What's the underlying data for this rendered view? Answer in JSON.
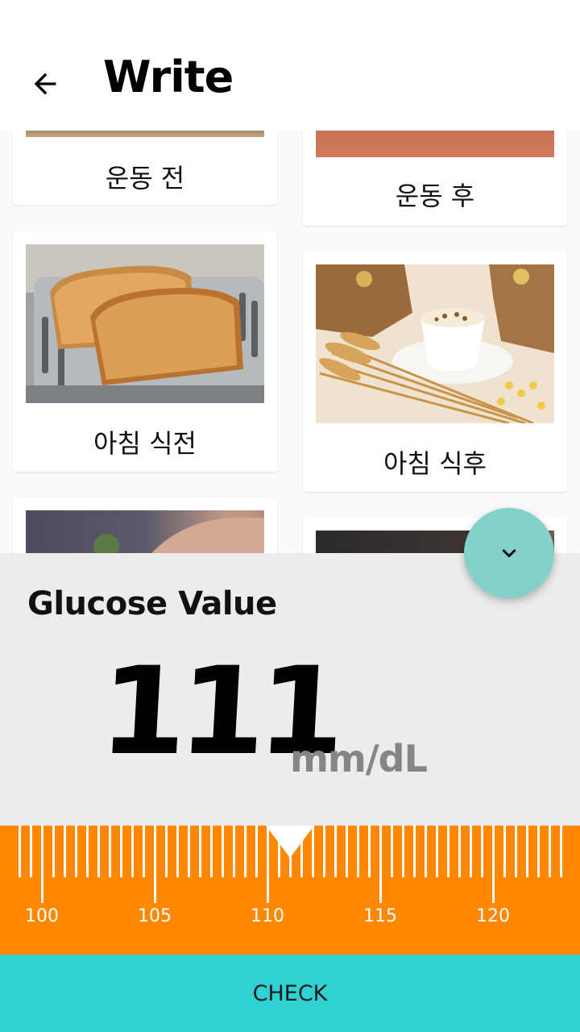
{
  "header": {
    "title": "Write",
    "back_icon": "arrow-back-icon"
  },
  "categories": [
    {
      "label": "운동 전",
      "image": "exercise-before-photo"
    },
    {
      "label": "운동 후",
      "image": "exercise-after-photo"
    },
    {
      "label": "아침 식전",
      "image": "toast-photo"
    },
    {
      "label": "아침 식후",
      "image": "cereal-wheat-photo"
    },
    {
      "label": "",
      "image": "lunch-before-photo"
    },
    {
      "label": "",
      "image": "lunch-after-photo"
    }
  ],
  "glucose": {
    "title": "Glucose Value",
    "value": "111",
    "unit": "mm/dL"
  },
  "fab": {
    "icon": "chevron-down-icon"
  },
  "ruler": {
    "min": 100,
    "max": 123,
    "step": 0.5,
    "selected": 111,
    "labels": [
      "100",
      "105",
      "110",
      "115",
      "120"
    ],
    "color": "#ff8800"
  },
  "check_button": {
    "label": "CHECK",
    "color": "#2fd1d3"
  },
  "colors": {
    "panel": "#ececec",
    "fab": "#84d0cb"
  }
}
